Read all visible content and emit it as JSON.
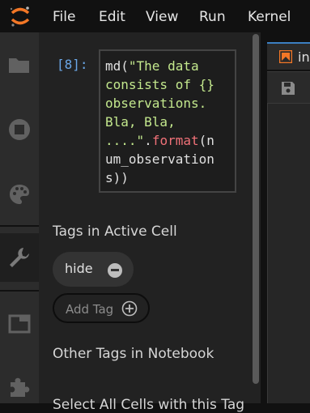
{
  "menubar": {
    "items": [
      "File",
      "Edit",
      "View",
      "Run",
      "Kernel"
    ]
  },
  "sidebar": {
    "icons": [
      "folder-icon",
      "stop-circle-icon",
      "palette-icon",
      "wrench-icon",
      "tab-icon",
      "puzzle-icon"
    ]
  },
  "cell": {
    "prompt": "[8]:",
    "code_lines": [
      [
        {
          "t": "md(",
          "c": "plain"
        },
        {
          "t": "\"The data",
          "c": "str"
        }
      ],
      [
        {
          "t": "consists of {}",
          "c": "str"
        }
      ],
      [
        {
          "t": "observations.",
          "c": "str"
        }
      ],
      [
        {
          "t": "Bla, Bla,",
          "c": "str"
        }
      ],
      [
        {
          "t": "....\"",
          "c": "str"
        },
        {
          "t": ".",
          "c": "plain"
        },
        {
          "t": "format",
          "c": "fn"
        },
        {
          "t": "(n",
          "c": "plain"
        }
      ],
      [
        {
          "t": "um_observation",
          "c": "plain"
        }
      ],
      [
        {
          "t": "s))",
          "c": "plain"
        }
      ]
    ]
  },
  "tags": {
    "active_heading": "Tags in Active Cell",
    "active_tags": [
      "hide"
    ],
    "add_label": "Add Tag",
    "other_heading": "Other Tags in Notebook",
    "select_all_label": "Select All Cells with this Tag"
  },
  "document": {
    "tab_label": "in"
  },
  "colors": {
    "accent": "#f37726",
    "prompt": "#6aa6e6",
    "tab_border": "#3c7fc2"
  }
}
